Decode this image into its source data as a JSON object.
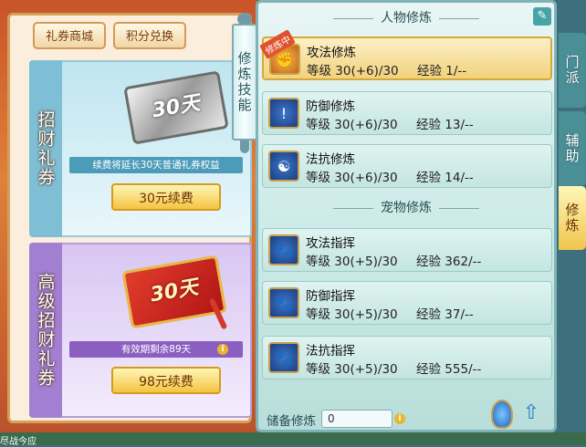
{
  "left_tabs": {
    "mall": "礼券商城",
    "points": "积分兑换"
  },
  "fortune_coupon": {
    "side_label": "招财礼券",
    "ticket_text": "30天",
    "note": "续费将延长30天普通礼券权益",
    "button": "30元续费"
  },
  "premium_coupon": {
    "side_label": "高级招财礼券",
    "ticket_text": "30天",
    "note": "有效期剩余89天",
    "button": "98元续费"
  },
  "scroll_tab": "修炼技能",
  "character_section": {
    "title": "人物修炼",
    "skills": [
      {
        "name": "攻法修炼",
        "level_label": "等级",
        "level": "30(+6)/30",
        "exp_label": "经验",
        "exp": "1/--",
        "badge": "修炼中",
        "icon": "fist-fire-icon"
      },
      {
        "name": "防御修炼",
        "level_label": "等级",
        "level": "30(+6)/30",
        "exp_label": "经验",
        "exp": "13/--",
        "icon": "shield-icon"
      },
      {
        "name": "法抗修炼",
        "level_label": "等级",
        "level": "30(+6)/30",
        "exp_label": "经验",
        "exp": "14/--",
        "icon": "taiji-icon"
      }
    ]
  },
  "pet_section": {
    "title": "宠物修炼",
    "skills": [
      {
        "name": "攻法指挥",
        "level_label": "等级",
        "level": "30(+5)/30",
        "exp_label": "经验",
        "exp": "362/--",
        "icon": "paw-attack-icon"
      },
      {
        "name": "防御指挥",
        "level_label": "等级",
        "level": "30(+5)/30",
        "exp_label": "经验",
        "exp": "37/--",
        "icon": "paw-shield-icon"
      },
      {
        "name": "法抗指挥",
        "level_label": "等级",
        "level": "30(+5)/30",
        "exp_label": "经验",
        "exp": "555/--",
        "icon": "paw-magic-icon"
      }
    ]
  },
  "reserve": {
    "label": "储备修炼",
    "value": "0"
  },
  "right_tabs": {
    "sect": "门派",
    "assist": "辅助",
    "cultivate": "修炼"
  },
  "bottom_text": "尽战今应",
  "colors": {
    "selected_row": "#f1d27d",
    "panel": "#c9e9e6",
    "accent_gold": "#d89a1c"
  }
}
